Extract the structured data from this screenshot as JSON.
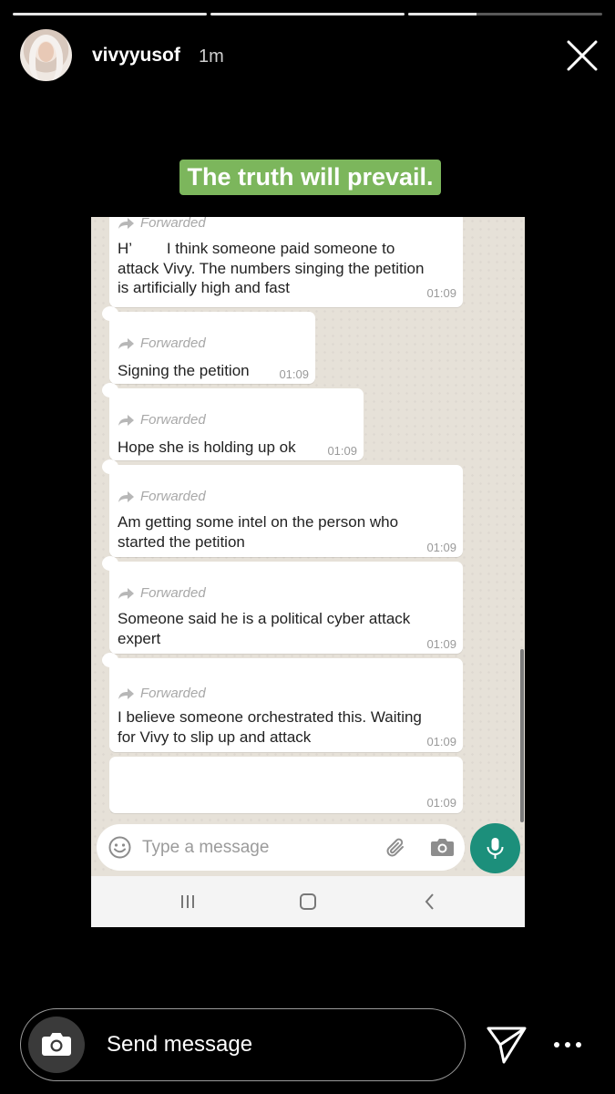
{
  "story": {
    "progress": [
      1.0,
      1.0,
      0.35
    ],
    "username": "vivyyusof",
    "time_ago": "1m",
    "caption": "The truth will prevail.",
    "caption_color": "#7cb65c"
  },
  "chat": {
    "forwarded_label": "Forwarded",
    "messages": [
      {
        "text_lines": [
          "H’        I think someone paid someone to",
          "attack Vivy. The numbers singing the petition",
          "is artificially high and fast"
        ],
        "time": "01:09"
      },
      {
        "text_lines": [
          "Signing the petition"
        ],
        "time": "01:09"
      },
      {
        "text_lines": [
          "Hope she is holding up ok"
        ],
        "time": "01:09"
      },
      {
        "text_lines": [
          "Am getting some intel on the person who",
          "started the petition"
        ],
        "time": "01:09"
      },
      {
        "text_lines": [
          "Someone said he is a political cyber attack",
          "expert"
        ],
        "time": "01:09"
      },
      {
        "text_lines": [
          "I believe someone orchestrated this. Waiting",
          "for Vivy to slip up and attack"
        ],
        "time": "01:09"
      },
      {
        "text_lines": [],
        "time": "01:09"
      }
    ],
    "input_placeholder": "Type a message",
    "accent_color": "#1c8f7b"
  },
  "bottom": {
    "send_placeholder": "Send message"
  }
}
